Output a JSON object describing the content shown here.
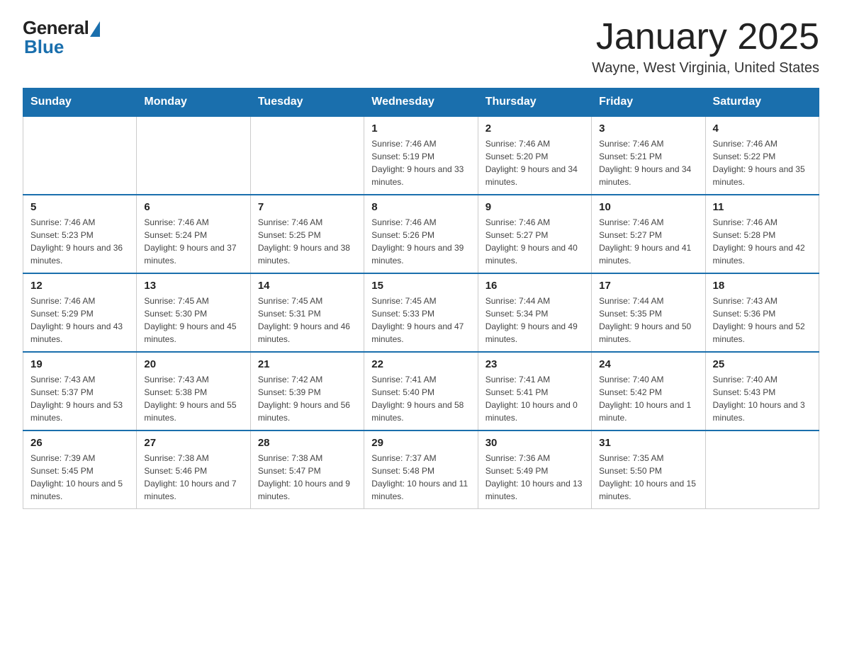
{
  "header": {
    "logo_general": "General",
    "logo_blue": "Blue",
    "month_title": "January 2025",
    "location": "Wayne, West Virginia, United States"
  },
  "days_of_week": [
    "Sunday",
    "Monday",
    "Tuesday",
    "Wednesday",
    "Thursday",
    "Friday",
    "Saturday"
  ],
  "weeks": [
    [
      {
        "day": "",
        "info": ""
      },
      {
        "day": "",
        "info": ""
      },
      {
        "day": "",
        "info": ""
      },
      {
        "day": "1",
        "info": "Sunrise: 7:46 AM\nSunset: 5:19 PM\nDaylight: 9 hours and 33 minutes."
      },
      {
        "day": "2",
        "info": "Sunrise: 7:46 AM\nSunset: 5:20 PM\nDaylight: 9 hours and 34 minutes."
      },
      {
        "day": "3",
        "info": "Sunrise: 7:46 AM\nSunset: 5:21 PM\nDaylight: 9 hours and 34 minutes."
      },
      {
        "day": "4",
        "info": "Sunrise: 7:46 AM\nSunset: 5:22 PM\nDaylight: 9 hours and 35 minutes."
      }
    ],
    [
      {
        "day": "5",
        "info": "Sunrise: 7:46 AM\nSunset: 5:23 PM\nDaylight: 9 hours and 36 minutes."
      },
      {
        "day": "6",
        "info": "Sunrise: 7:46 AM\nSunset: 5:24 PM\nDaylight: 9 hours and 37 minutes."
      },
      {
        "day": "7",
        "info": "Sunrise: 7:46 AM\nSunset: 5:25 PM\nDaylight: 9 hours and 38 minutes."
      },
      {
        "day": "8",
        "info": "Sunrise: 7:46 AM\nSunset: 5:26 PM\nDaylight: 9 hours and 39 minutes."
      },
      {
        "day": "9",
        "info": "Sunrise: 7:46 AM\nSunset: 5:27 PM\nDaylight: 9 hours and 40 minutes."
      },
      {
        "day": "10",
        "info": "Sunrise: 7:46 AM\nSunset: 5:27 PM\nDaylight: 9 hours and 41 minutes."
      },
      {
        "day": "11",
        "info": "Sunrise: 7:46 AM\nSunset: 5:28 PM\nDaylight: 9 hours and 42 minutes."
      }
    ],
    [
      {
        "day": "12",
        "info": "Sunrise: 7:46 AM\nSunset: 5:29 PM\nDaylight: 9 hours and 43 minutes."
      },
      {
        "day": "13",
        "info": "Sunrise: 7:45 AM\nSunset: 5:30 PM\nDaylight: 9 hours and 45 minutes."
      },
      {
        "day": "14",
        "info": "Sunrise: 7:45 AM\nSunset: 5:31 PM\nDaylight: 9 hours and 46 minutes."
      },
      {
        "day": "15",
        "info": "Sunrise: 7:45 AM\nSunset: 5:33 PM\nDaylight: 9 hours and 47 minutes."
      },
      {
        "day": "16",
        "info": "Sunrise: 7:44 AM\nSunset: 5:34 PM\nDaylight: 9 hours and 49 minutes."
      },
      {
        "day": "17",
        "info": "Sunrise: 7:44 AM\nSunset: 5:35 PM\nDaylight: 9 hours and 50 minutes."
      },
      {
        "day": "18",
        "info": "Sunrise: 7:43 AM\nSunset: 5:36 PM\nDaylight: 9 hours and 52 minutes."
      }
    ],
    [
      {
        "day": "19",
        "info": "Sunrise: 7:43 AM\nSunset: 5:37 PM\nDaylight: 9 hours and 53 minutes."
      },
      {
        "day": "20",
        "info": "Sunrise: 7:43 AM\nSunset: 5:38 PM\nDaylight: 9 hours and 55 minutes."
      },
      {
        "day": "21",
        "info": "Sunrise: 7:42 AM\nSunset: 5:39 PM\nDaylight: 9 hours and 56 minutes."
      },
      {
        "day": "22",
        "info": "Sunrise: 7:41 AM\nSunset: 5:40 PM\nDaylight: 9 hours and 58 minutes."
      },
      {
        "day": "23",
        "info": "Sunrise: 7:41 AM\nSunset: 5:41 PM\nDaylight: 10 hours and 0 minutes."
      },
      {
        "day": "24",
        "info": "Sunrise: 7:40 AM\nSunset: 5:42 PM\nDaylight: 10 hours and 1 minute."
      },
      {
        "day": "25",
        "info": "Sunrise: 7:40 AM\nSunset: 5:43 PM\nDaylight: 10 hours and 3 minutes."
      }
    ],
    [
      {
        "day": "26",
        "info": "Sunrise: 7:39 AM\nSunset: 5:45 PM\nDaylight: 10 hours and 5 minutes."
      },
      {
        "day": "27",
        "info": "Sunrise: 7:38 AM\nSunset: 5:46 PM\nDaylight: 10 hours and 7 minutes."
      },
      {
        "day": "28",
        "info": "Sunrise: 7:38 AM\nSunset: 5:47 PM\nDaylight: 10 hours and 9 minutes."
      },
      {
        "day": "29",
        "info": "Sunrise: 7:37 AM\nSunset: 5:48 PM\nDaylight: 10 hours and 11 minutes."
      },
      {
        "day": "30",
        "info": "Sunrise: 7:36 AM\nSunset: 5:49 PM\nDaylight: 10 hours and 13 minutes."
      },
      {
        "day": "31",
        "info": "Sunrise: 7:35 AM\nSunset: 5:50 PM\nDaylight: 10 hours and 15 minutes."
      },
      {
        "day": "",
        "info": ""
      }
    ]
  ]
}
